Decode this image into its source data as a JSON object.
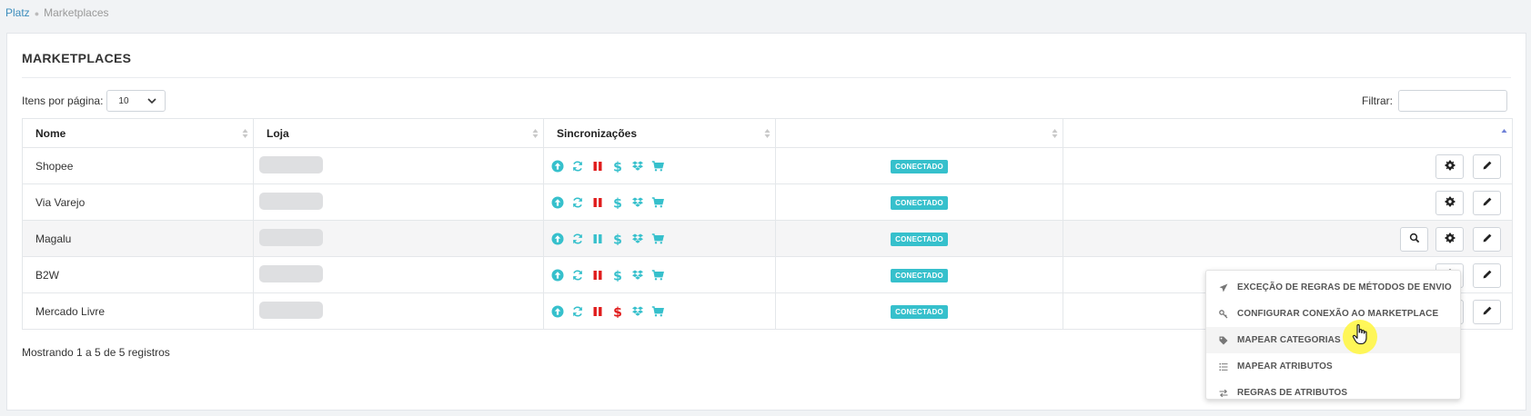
{
  "breadcrumb": {
    "home": "Platz",
    "current": "Marketplaces"
  },
  "card": {
    "title": "MARKETPLACES"
  },
  "controls": {
    "per_page_label": "Itens por página:",
    "per_page_value": "10",
    "filter_label": "Filtrar:",
    "filter_value": ""
  },
  "table": {
    "headers": [
      "Nome",
      "Loja",
      "Sincronizações",
      "",
      ""
    ],
    "rows": [
      {
        "name": "Shopee",
        "status": "CONECTADO",
        "pause_color": "#e01b1b",
        "dollar_color": "#36c0cc",
        "has_search": false
      },
      {
        "name": "Via Varejo",
        "status": "CONECTADO",
        "pause_color": "#e01b1b",
        "dollar_color": "#36c0cc",
        "has_search": false
      },
      {
        "name": "Magalu",
        "status": "CONECTADO",
        "pause_color": "#36c0cc",
        "dollar_color": "#36c0cc",
        "has_search": true
      },
      {
        "name": "B2W",
        "status": "CONECTADO",
        "pause_color": "#e01b1b",
        "dollar_color": "#36c0cc",
        "has_search": false
      },
      {
        "name": "Mercado Livre",
        "status": "CONECTADO",
        "pause_color": "#e01b1b",
        "dollar_color": "#e01b1b",
        "has_search": false
      }
    ]
  },
  "footer": {
    "info": "Mostrando 1 a 5 de 5 registros",
    "next": "›",
    "last": "»"
  },
  "dropdown": {
    "items": [
      {
        "label": "EXCEÇÃO DE REGRAS DE MÉTODOS DE ENVIO",
        "icon": "paper-plane-icon"
      },
      {
        "label": "CONFIGURAR CONEXÃO AO MARKETPLACE",
        "icon": "key-icon"
      },
      {
        "label": "MAPEAR CATEGORIAS",
        "icon": "tag-icon"
      },
      {
        "label": "MAPEAR ATRIBUTOS",
        "icon": "list-icon"
      },
      {
        "label": "REGRAS DE ATRIBUTOS",
        "icon": "exchange-icon"
      }
    ]
  },
  "colors": {
    "accent": "#36c0cc",
    "danger": "#e01b1b",
    "link": "#3c8dbc"
  }
}
